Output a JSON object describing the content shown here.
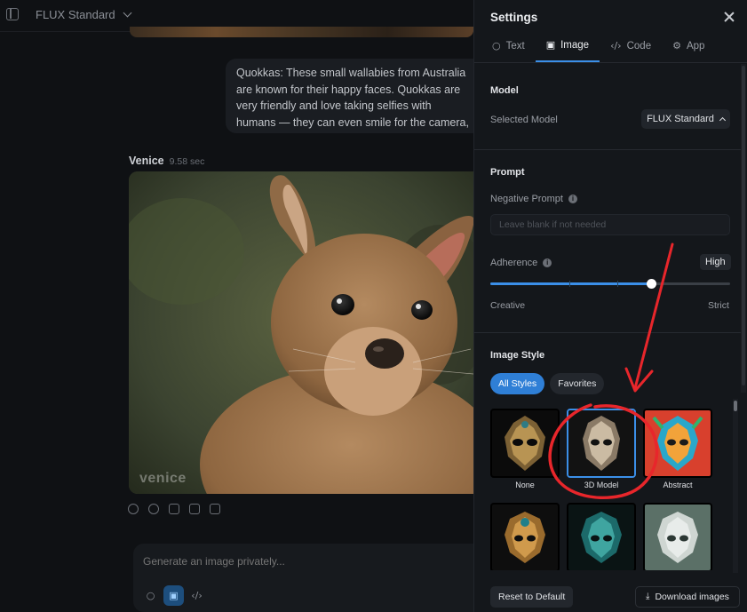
{
  "topbar": {
    "model_name": "FLUX Standard"
  },
  "chat": {
    "user_message": "Quokkas: These small wallabies from Australia are known for their happy faces. Quokkas are very friendly and love taking selfies with humans — they can even smile for the camera, making them the happiest animal in the world.",
    "bot_name": "Venice",
    "bot_time": "9.58 sec",
    "watermark": "venice",
    "composer_placeholder": "Generate an image privately..."
  },
  "settings": {
    "title": "Settings",
    "tabs": [
      {
        "label": "Text",
        "icon": "chat-bubble-icon"
      },
      {
        "label": "Image",
        "icon": "image-icon"
      },
      {
        "label": "Code",
        "icon": "code-icon"
      },
      {
        "label": "App",
        "icon": "gear-icon"
      }
    ],
    "active_tab": "Image",
    "model": {
      "section": "Model",
      "selected_label": "Selected Model",
      "selected_value": "FLUX Standard"
    },
    "prompt": {
      "section": "Prompt",
      "negative_label": "Negative Prompt",
      "negative_placeholder": "Leave blank if not needed",
      "adherence_label": "Adherence",
      "adherence_value": "High",
      "adherence_level": 0.67,
      "min_label": "Creative",
      "max_label": "Strict"
    },
    "image_style": {
      "section": "Image Style",
      "filters": [
        "All Styles",
        "Favorites"
      ],
      "active_filter": "All Styles",
      "styles": [
        {
          "name": "None",
          "selected": false
        },
        {
          "name": "3D Model",
          "selected": true
        },
        {
          "name": "Abstract",
          "selected": false
        },
        {
          "name": "",
          "selected": false
        },
        {
          "name": "",
          "selected": false
        },
        {
          "name": "",
          "selected": false
        }
      ]
    },
    "footer": {
      "reset_label": "Reset to Default",
      "download_label": "Download images"
    }
  },
  "colors": {
    "accent": "#3b8fe8",
    "annotation": "#e8262b",
    "panel_bg": "#14171b",
    "page_bg": "#0f1114"
  }
}
